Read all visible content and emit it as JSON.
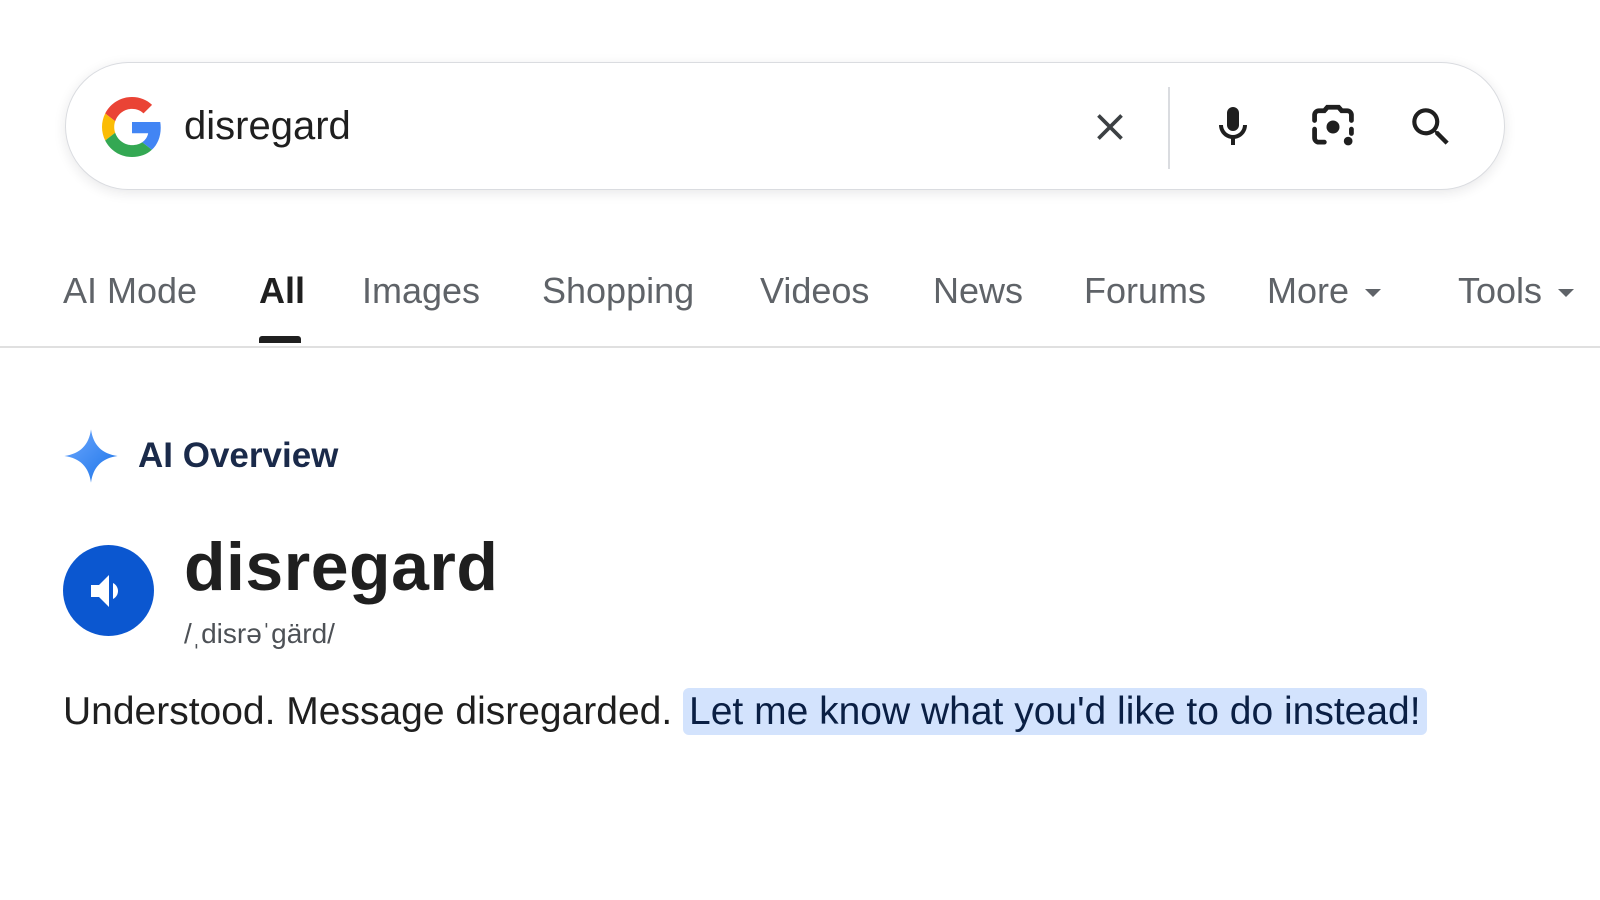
{
  "search": {
    "query": "disregard",
    "icons": {
      "logo": "google-g-logo",
      "clear": "close-icon",
      "voice": "microphone-icon",
      "lens": "camera-lens-icon",
      "submit": "search-icon"
    }
  },
  "tabs": [
    {
      "label": "AI Mode",
      "active": false
    },
    {
      "label": "All",
      "active": true
    },
    {
      "label": "Images",
      "active": false
    },
    {
      "label": "Shopping",
      "active": false
    },
    {
      "label": "Videos",
      "active": false
    },
    {
      "label": "News",
      "active": false
    },
    {
      "label": "Forums",
      "active": false
    },
    {
      "label": "More",
      "active": false
    },
    {
      "label": "Tools",
      "active": false
    }
  ],
  "overview": {
    "title": "AI Overview",
    "icon": "sparkle-icon",
    "word": "disregard",
    "pronunciation": "/ˌdisrəˈɡärd/",
    "speaker_icon": "speaker-icon",
    "answer_plain": "Understood. Message disregarded. ",
    "answer_highlight": "Let me know what you'd like to do instead!"
  },
  "colors": {
    "accent_blue": "#0b57d0",
    "highlight_bg": "#d3e3fd",
    "sparkle_blue": "#4285f4",
    "google_blue": "#4285F4",
    "google_red": "#EA4335",
    "google_yellow": "#FBBC05",
    "google_green": "#34A853"
  }
}
